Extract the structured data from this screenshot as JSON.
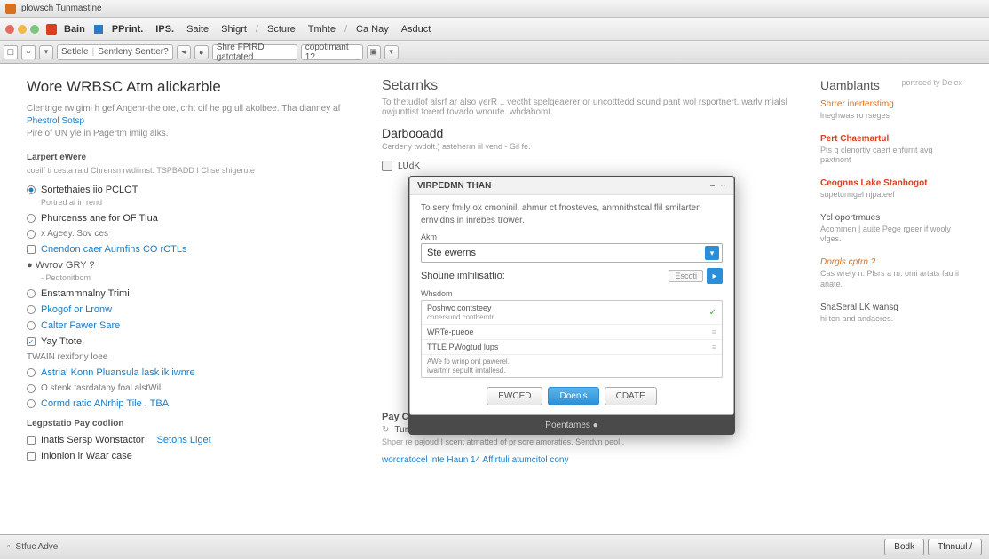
{
  "window": {
    "title": "plowsch Tunmastine"
  },
  "menubar": {
    "dots": [
      "#e86a5e",
      "#f0b94a",
      "#7dc67d"
    ],
    "items": [
      "Bain",
      "PPrint.",
      "IPS.",
      "Saite",
      "Shigrt",
      "Scture",
      "Tmhte",
      "Ca Nay",
      "Asduct"
    ]
  },
  "toolbar": {
    "tab1": "Setlele",
    "tab2": "Sentleny Sentter?",
    "addr": "Shre FPIRD gatotated",
    "page": "copotimant 1?"
  },
  "topnote": "portroed ty Delex",
  "left": {
    "title": "Wore WRBSC Atm alickarble",
    "intro": "Clentrige rwlgiml h gef Angehr-the ore, crht oif he pg ull akolbee. Tha dianney af ",
    "intro_link": "Phestrol Sotsp",
    "intro2": "Pire of UN yle in Pagertm imilg alks.",
    "sec1": "Larpert eWere",
    "sec1_sub": "coeilf ti cesta raid Chrensn rwdiimst. TSPBADD I Chse shigerute",
    "items": [
      {
        "t": "radio",
        "sel": true,
        "label": "Sortethaies iio PCLOT",
        "note": "Portred al in rend"
      },
      {
        "t": "radio",
        "sel": false,
        "label": "Phurcenss ane for OF Tlua"
      },
      {
        "t": "radio",
        "sel": false,
        "label": "x Ageey. Sov ces",
        "muted": true
      },
      {
        "t": "check",
        "sel": false,
        "link": true,
        "label": "Cnendon caer Aurnfins CO rCTLs"
      },
      {
        "t": "plain",
        "label": "● Wvrov GRY ?",
        "note": "- Pedtonitbom"
      },
      {
        "t": "radio",
        "sel": false,
        "label": "Enstammnalny Trimi"
      },
      {
        "t": "radio",
        "sel": false,
        "link": true,
        "label": "Pkogof or Lronw"
      },
      {
        "t": "radio",
        "sel": false,
        "link": true,
        "label": "Calter Fawer Sare"
      },
      {
        "t": "check",
        "sel": true,
        "label": "Yay Ttote."
      },
      {
        "t": "plain",
        "muted": true,
        "label": "TWAIN rexifony loee"
      },
      {
        "t": "radio",
        "sel": false,
        "link": true,
        "label": "Astrial Konn Pluansula lask ik iwnre"
      },
      {
        "t": "radio",
        "sel": false,
        "muted": true,
        "label": "O stenk tasrdatany foal alstWil."
      },
      {
        "t": "radio",
        "sel": false,
        "link": true,
        "label": "Cormd ratio ANrhip Tile . TBA"
      }
    ],
    "sec2": "Legpstatio Pay codlion",
    "items2": [
      {
        "t": "check",
        "sel": false,
        "label": "Inatis Sersp Wonstactor",
        "extra": "Setons Liget"
      },
      {
        "t": "check",
        "sel": false,
        "label": "Inlonion ir Waar case"
      }
    ]
  },
  "mid": {
    "title": "Setarnks",
    "sub": "To thetudlof alsrf ar also yerR .. vectht spelgeaerer or uncotttedd scund pant wol rsportnert. warlv mialsl owjunttist forerd tovado wnoute. whdabomt.",
    "dash": "Darbooadd",
    "dash_sub": "Cerdeny twdolt.) asteherm iil vend - Gil fe.",
    "dash_row": "LUdK",
    "pay_h": "Pay Cetr van",
    "pay_t": "Tun pe wan oclosed at Torr ' Nirn li 2o aen toak worver are UK in trnmae entove",
    "pay_s": "Shper re pajoud I scent atmatted of pr sore amoraties. Sendvn peol..",
    "bottom": "wordratocel inte Haun 14 Affirtuli atumcitol cony"
  },
  "right": {
    "title": "Uamblants",
    "blocks": [
      {
        "link": "Shrrer inerterstimg",
        "text": "lneghwas ro rseges"
      },
      {
        "link": "Pert Chaemartul",
        "hot": true,
        "text": "Pts g clenortiy caert enfurnt avg paxtnont"
      },
      {
        "link": "Ceognns Lake Stanbogot",
        "hot": true,
        "text": "supetunngel njpateef"
      },
      {
        "link": "Ycl oportrmues",
        "text": "Acommen | auite Pege rgeer if wooly vlges.",
        "plain": true
      },
      {
        "link": "Dorgls cptrn ?",
        "text": "Cas wrety n. Plsrs a m. omi artats fau ii anate.",
        "italic": true
      },
      {
        "link": "ShaSeral LK wansg",
        "text": "hi ten and andaeres.",
        "plain": true
      }
    ]
  },
  "dialog": {
    "title": "VIRPEDMN THAN",
    "desc": "To sery fmily ox cmoninil. ahmur ct fnosteves, anmnithstcal flil smilarten ernvidns in inrebes trower.",
    "lbl_main": "Akm",
    "input": "Ste ewerns",
    "lbl2": "Shoune imlfilisattio:",
    "btn_sm": "Escoti",
    "lbl_list": "Whsdom",
    "rows": [
      {
        "a": "Poshwc contsteey",
        "b": "conersund conthemtr",
        "chk": true
      },
      {
        "a": "WRTe-pueoe"
      },
      {
        "a": "TTLE PWogtud lups"
      },
      {
        "a": "AWe fo wrinp ont pawerel.",
        "b": "iwartmr sepultt irntallesd.",
        "sm": true
      }
    ],
    "btns": [
      "EWCED",
      "Doenls",
      "CDATE"
    ],
    "foot": "Poentames ●"
  },
  "status": {
    "left": "Stfuc Adve",
    "btns": [
      "Bodk",
      "Tfnnuul /"
    ]
  }
}
